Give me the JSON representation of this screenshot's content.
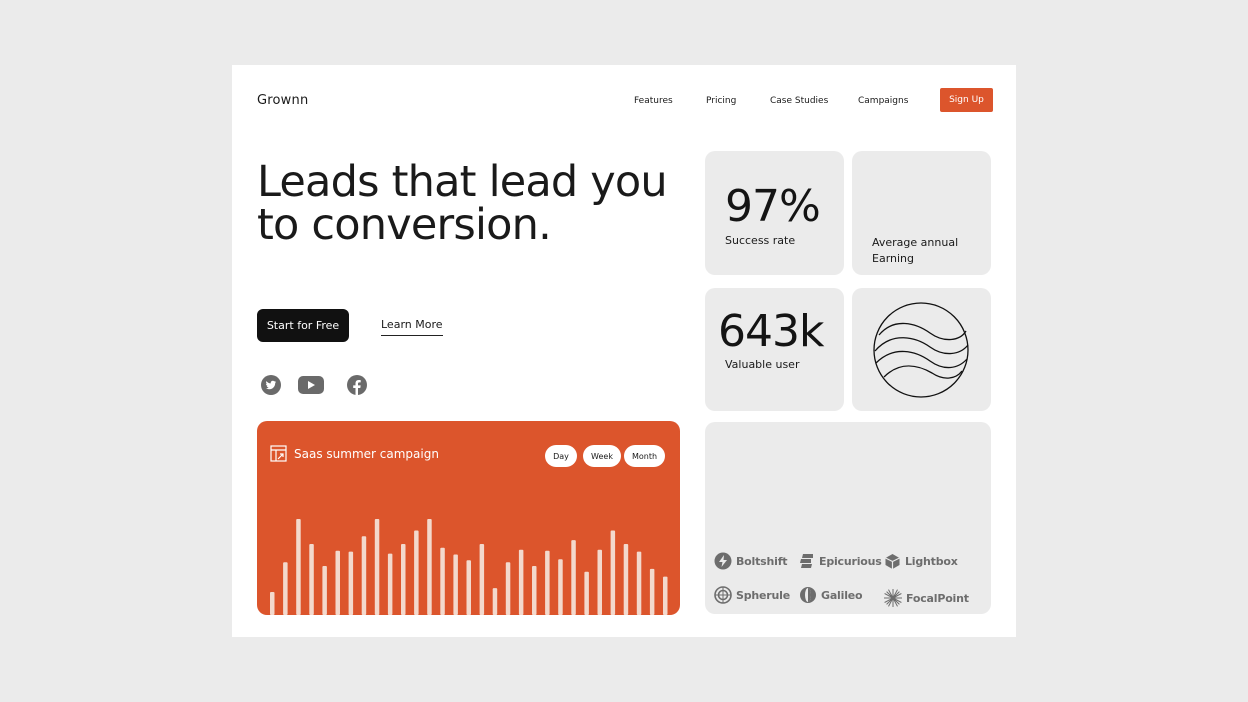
{
  "brand": "Grownn",
  "nav": {
    "items": [
      "Features",
      "Pricing",
      "Case Studies",
      "Campaigns"
    ],
    "signup": "Sign Up"
  },
  "hero": {
    "headline_line1": "Leads that lead you",
    "headline_line2": "to conversion.",
    "primary_cta": "Start for Free",
    "secondary_cta": "Learn More"
  },
  "social": [
    "twitter-icon",
    "youtube-icon",
    "facebook-icon"
  ],
  "campaign": {
    "title": "Saas summer campaign",
    "periods": [
      "Day",
      "Week",
      "Month"
    ],
    "color": "#dc552c",
    "bar_levels": [
      0.24,
      0.55,
      1.0,
      0.74,
      0.51,
      0.67,
      0.66,
      0.82,
      1.0,
      0.64,
      0.74,
      0.88,
      1.0,
      0.7,
      0.63,
      0.57,
      0.74,
      0.28,
      0.55,
      0.68,
      0.51,
      0.67,
      0.58,
      0.78,
      0.45,
      0.68,
      0.88,
      0.74,
      0.66,
      0.48,
      0.4
    ]
  },
  "stats": {
    "success_value": "97%",
    "success_label": "Success rate",
    "earning_label_line1": "Average annual",
    "earning_label_line2": "Earning",
    "users_value": "643k",
    "users_label": "Valuable user"
  },
  "partners": [
    "Boltshift",
    "Epicurious",
    "Lightbox",
    "Spherule",
    "Galileo",
    "FocalPoint"
  ]
}
